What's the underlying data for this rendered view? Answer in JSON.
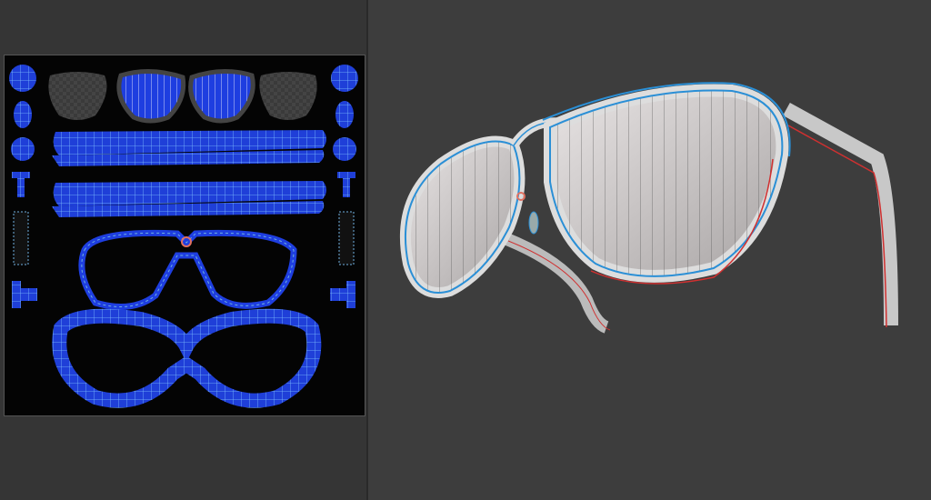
{
  "colors": {
    "uv_island": "#1f3fd8",
    "uv_edge": "#6fb0e0",
    "frame_edge": "#2a8fd6",
    "viewport_bg": "#3d3d3d",
    "seam": "#d03030"
  }
}
